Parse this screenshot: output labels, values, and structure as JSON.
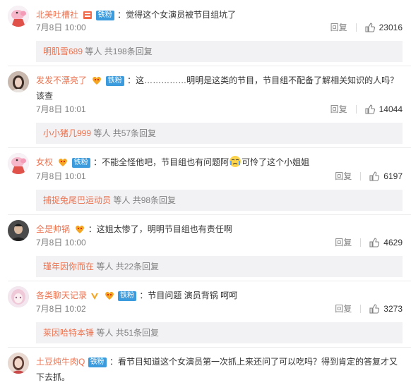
{
  "comments": [
    {
      "user": "北美吐槽社",
      "fan_badge": "铁粉",
      "text": "觉得这个女演员被节目组坑了",
      "time": "7月8日 10:00",
      "reply_label": "回复",
      "likes": "23016",
      "sub_name": "明肌雪689",
      "sub_suffix": "等人 共198条回复",
      "avatar_icon": "peppa-pig-avatar"
    },
    {
      "user": "发发不漂亮了",
      "fan_badge": "铁粉",
      "text": "这……………明明是这类的节目，节目组不配备了解相关知识的人吗？该查",
      "time": "7月8日 10:01",
      "reply_label": "回复",
      "likes": "14044",
      "sub_name": "小小猪几999",
      "sub_suffix": "等人 共57条回复",
      "avatar_icon": "woman-portrait-avatar"
    },
    {
      "user": "女权",
      "fan_badge": "铁粉",
      "text_before": "不能全怪他吧，节目组也有问题阿",
      "text_after": "可怜了这个小姐姐",
      "time": "7月8日 10:01",
      "reply_label": "回复",
      "likes": "6197",
      "sub_name": "捕捉兔尾巴运动员",
      "sub_suffix": "等人 共98条回复",
      "avatar_icon": "peppa-pig-avatar"
    },
    {
      "user": "全是帅锅",
      "text": "这姐太惨了，明明节目组也有责任啊",
      "time": "7月8日 10:00",
      "reply_label": "回复",
      "likes": "4629",
      "sub_name": "瑾年因你而在",
      "sub_suffix": "等人 共22条回复",
      "avatar_icon": "man-portrait-avatar"
    },
    {
      "user": "各类聊天记录",
      "fan_badge": "铁粉",
      "text": "节目问题 演员背锅 呵呵",
      "time": "7月8日 10:02",
      "reply_label": "回复",
      "likes": "3273",
      "sub_name": "莱因哈特本锤",
      "sub_suffix": "等人 共51条回复",
      "avatar_icon": "anime-girl-avatar"
    },
    {
      "user": "土豆炖牛肉Q",
      "fan_badge": "铁粉",
      "text": "看节目知道这个女演员第一次抓上来还问了可以吃吗？得到肯定的答复才又下去抓。",
      "avatar_icon": "woman-portrait-avatar"
    }
  ],
  "colors": {
    "username": "#eb7350",
    "fan_badge": "#3c9bdc",
    "reply_box": "#f2f2f5"
  }
}
